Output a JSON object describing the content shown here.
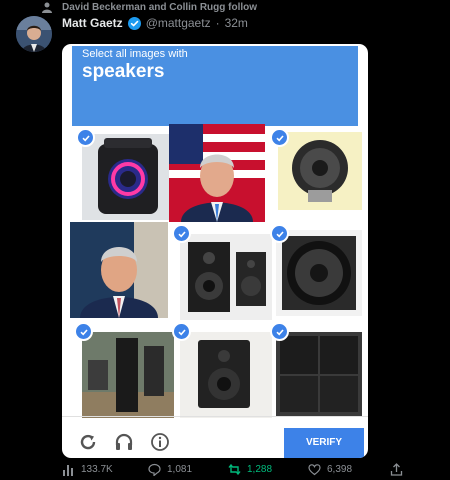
{
  "social_context": {
    "text": "David Beckerman and Collin Rugg follow",
    "icon": "person-icon"
  },
  "tweet": {
    "author_name": "Matt Gaetz",
    "handle": "@mattgaetz",
    "separator": "·",
    "time": "32m",
    "verified_color": "#1d9bf0"
  },
  "captcha": {
    "instruction_line1": "Select all images with",
    "instruction_line2": "speakers",
    "header_color": "#4a90e2",
    "tiles": [
      {
        "content": "portable-party-speaker",
        "checked": true
      },
      {
        "content": "man-with-flag",
        "checked": false
      },
      {
        "content": "speaker-driver",
        "checked": true
      },
      {
        "content": "man-portrait",
        "checked": false
      },
      {
        "content": "bookshelf-speakers",
        "checked": true
      },
      {
        "content": "speaker-woofer",
        "checked": true
      },
      {
        "content": "tower-speakers",
        "checked": true
      },
      {
        "content": "studio-monitor",
        "checked": true
      },
      {
        "content": "stacked-cabinets",
        "checked": true
      }
    ],
    "footer_icons": [
      "refresh-icon",
      "headphones-icon",
      "info-icon"
    ],
    "verify_label": "VERIFY"
  },
  "actions": {
    "views": "133.7K",
    "replies": "1,081",
    "retweets": "1,288",
    "likes": "6,398"
  }
}
